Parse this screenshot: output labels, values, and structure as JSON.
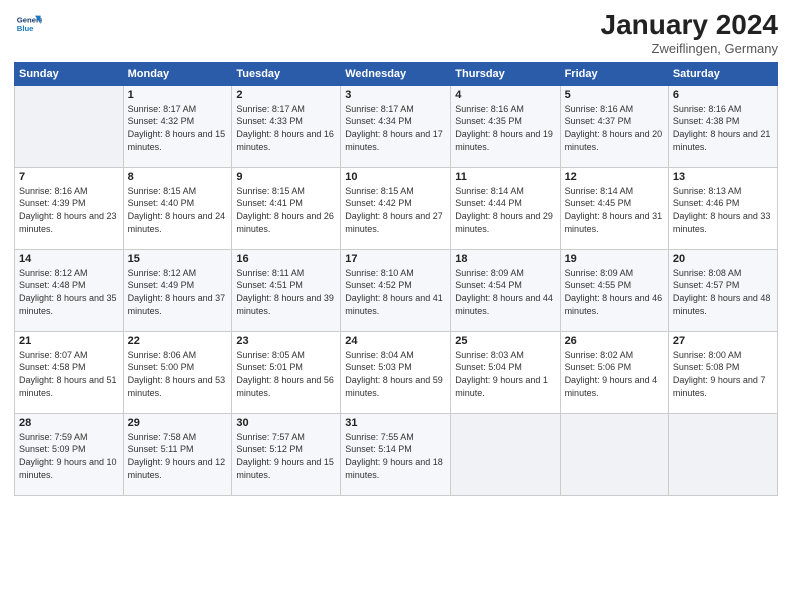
{
  "header": {
    "logo_line1": "General",
    "logo_line2": "Blue",
    "title": "January 2024",
    "subtitle": "Zweiflingen, Germany"
  },
  "calendar": {
    "days_of_week": [
      "Sunday",
      "Monday",
      "Tuesday",
      "Wednesday",
      "Thursday",
      "Friday",
      "Saturday"
    ],
    "weeks": [
      [
        {
          "day": "",
          "sunrise": "",
          "sunset": "",
          "daylight": ""
        },
        {
          "day": "1",
          "sunrise": "Sunrise: 8:17 AM",
          "sunset": "Sunset: 4:32 PM",
          "daylight": "Daylight: 8 hours and 15 minutes."
        },
        {
          "day": "2",
          "sunrise": "Sunrise: 8:17 AM",
          "sunset": "Sunset: 4:33 PM",
          "daylight": "Daylight: 8 hours and 16 minutes."
        },
        {
          "day": "3",
          "sunrise": "Sunrise: 8:17 AM",
          "sunset": "Sunset: 4:34 PM",
          "daylight": "Daylight: 8 hours and 17 minutes."
        },
        {
          "day": "4",
          "sunrise": "Sunrise: 8:16 AM",
          "sunset": "Sunset: 4:35 PM",
          "daylight": "Daylight: 8 hours and 19 minutes."
        },
        {
          "day": "5",
          "sunrise": "Sunrise: 8:16 AM",
          "sunset": "Sunset: 4:37 PM",
          "daylight": "Daylight: 8 hours and 20 minutes."
        },
        {
          "day": "6",
          "sunrise": "Sunrise: 8:16 AM",
          "sunset": "Sunset: 4:38 PM",
          "daylight": "Daylight: 8 hours and 21 minutes."
        }
      ],
      [
        {
          "day": "7",
          "sunrise": "Sunrise: 8:16 AM",
          "sunset": "Sunset: 4:39 PM",
          "daylight": "Daylight: 8 hours and 23 minutes."
        },
        {
          "day": "8",
          "sunrise": "Sunrise: 8:15 AM",
          "sunset": "Sunset: 4:40 PM",
          "daylight": "Daylight: 8 hours and 24 minutes."
        },
        {
          "day": "9",
          "sunrise": "Sunrise: 8:15 AM",
          "sunset": "Sunset: 4:41 PM",
          "daylight": "Daylight: 8 hours and 26 minutes."
        },
        {
          "day": "10",
          "sunrise": "Sunrise: 8:15 AM",
          "sunset": "Sunset: 4:42 PM",
          "daylight": "Daylight: 8 hours and 27 minutes."
        },
        {
          "day": "11",
          "sunrise": "Sunrise: 8:14 AM",
          "sunset": "Sunset: 4:44 PM",
          "daylight": "Daylight: 8 hours and 29 minutes."
        },
        {
          "day": "12",
          "sunrise": "Sunrise: 8:14 AM",
          "sunset": "Sunset: 4:45 PM",
          "daylight": "Daylight: 8 hours and 31 minutes."
        },
        {
          "day": "13",
          "sunrise": "Sunrise: 8:13 AM",
          "sunset": "Sunset: 4:46 PM",
          "daylight": "Daylight: 8 hours and 33 minutes."
        }
      ],
      [
        {
          "day": "14",
          "sunrise": "Sunrise: 8:12 AM",
          "sunset": "Sunset: 4:48 PM",
          "daylight": "Daylight: 8 hours and 35 minutes."
        },
        {
          "day": "15",
          "sunrise": "Sunrise: 8:12 AM",
          "sunset": "Sunset: 4:49 PM",
          "daylight": "Daylight: 8 hours and 37 minutes."
        },
        {
          "day": "16",
          "sunrise": "Sunrise: 8:11 AM",
          "sunset": "Sunset: 4:51 PM",
          "daylight": "Daylight: 8 hours and 39 minutes."
        },
        {
          "day": "17",
          "sunrise": "Sunrise: 8:10 AM",
          "sunset": "Sunset: 4:52 PM",
          "daylight": "Daylight: 8 hours and 41 minutes."
        },
        {
          "day": "18",
          "sunrise": "Sunrise: 8:09 AM",
          "sunset": "Sunset: 4:54 PM",
          "daylight": "Daylight: 8 hours and 44 minutes."
        },
        {
          "day": "19",
          "sunrise": "Sunrise: 8:09 AM",
          "sunset": "Sunset: 4:55 PM",
          "daylight": "Daylight: 8 hours and 46 minutes."
        },
        {
          "day": "20",
          "sunrise": "Sunrise: 8:08 AM",
          "sunset": "Sunset: 4:57 PM",
          "daylight": "Daylight: 8 hours and 48 minutes."
        }
      ],
      [
        {
          "day": "21",
          "sunrise": "Sunrise: 8:07 AM",
          "sunset": "Sunset: 4:58 PM",
          "daylight": "Daylight: 8 hours and 51 minutes."
        },
        {
          "day": "22",
          "sunrise": "Sunrise: 8:06 AM",
          "sunset": "Sunset: 5:00 PM",
          "daylight": "Daylight: 8 hours and 53 minutes."
        },
        {
          "day": "23",
          "sunrise": "Sunrise: 8:05 AM",
          "sunset": "Sunset: 5:01 PM",
          "daylight": "Daylight: 8 hours and 56 minutes."
        },
        {
          "day": "24",
          "sunrise": "Sunrise: 8:04 AM",
          "sunset": "Sunset: 5:03 PM",
          "daylight": "Daylight: 8 hours and 59 minutes."
        },
        {
          "day": "25",
          "sunrise": "Sunrise: 8:03 AM",
          "sunset": "Sunset: 5:04 PM",
          "daylight": "Daylight: 9 hours and 1 minute."
        },
        {
          "day": "26",
          "sunrise": "Sunrise: 8:02 AM",
          "sunset": "Sunset: 5:06 PM",
          "daylight": "Daylight: 9 hours and 4 minutes."
        },
        {
          "day": "27",
          "sunrise": "Sunrise: 8:00 AM",
          "sunset": "Sunset: 5:08 PM",
          "daylight": "Daylight: 9 hours and 7 minutes."
        }
      ],
      [
        {
          "day": "28",
          "sunrise": "Sunrise: 7:59 AM",
          "sunset": "Sunset: 5:09 PM",
          "daylight": "Daylight: 9 hours and 10 minutes."
        },
        {
          "day": "29",
          "sunrise": "Sunrise: 7:58 AM",
          "sunset": "Sunset: 5:11 PM",
          "daylight": "Daylight: 9 hours and 12 minutes."
        },
        {
          "day": "30",
          "sunrise": "Sunrise: 7:57 AM",
          "sunset": "Sunset: 5:12 PM",
          "daylight": "Daylight: 9 hours and 15 minutes."
        },
        {
          "day": "31",
          "sunrise": "Sunrise: 7:55 AM",
          "sunset": "Sunset: 5:14 PM",
          "daylight": "Daylight: 9 hours and 18 minutes."
        },
        {
          "day": "",
          "sunrise": "",
          "sunset": "",
          "daylight": ""
        },
        {
          "day": "",
          "sunrise": "",
          "sunset": "",
          "daylight": ""
        },
        {
          "day": "",
          "sunrise": "",
          "sunset": "",
          "daylight": ""
        }
      ]
    ]
  }
}
